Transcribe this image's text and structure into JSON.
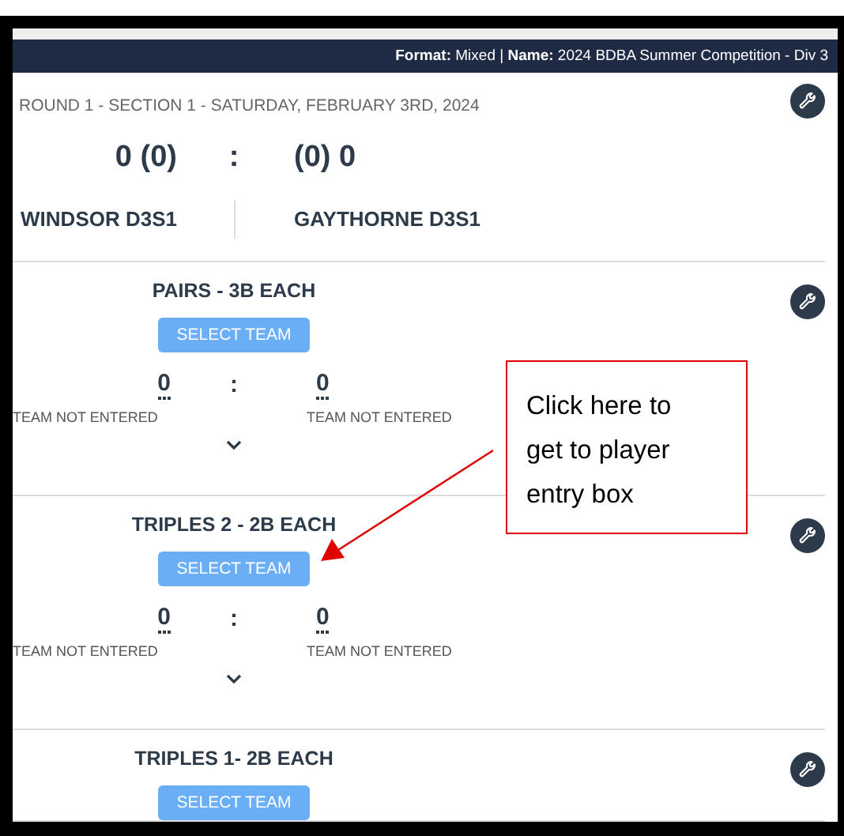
{
  "header": {
    "info": "**Format:** Mixed | **Name:** 2024 BDBA Summer Competition - Div 3"
  },
  "match": {
    "round": "ROUND 1 - SECTION 1 - SATURDAY, FEBRUARY 3RD, 2024",
    "home_score": "0 (0)",
    "separator": ":",
    "away_score": "(0) 0",
    "home_team": "WINDSOR D3S1",
    "away_team": "GAYTHORNE D3S1"
  },
  "games": [
    {
      "title": "PAIRS - 3B EACH",
      "button": "SELECT TEAM",
      "home_score": "0",
      "separator": ":",
      "away_score": "0",
      "home_status": "TEAM NOT ENTERED",
      "away_status": "TEAM NOT ENTERED"
    },
    {
      "title": "TRIPLES 2 - 2B EACH",
      "button": "SELECT TEAM",
      "home_score": "0",
      "separator": ":",
      "away_score": "0",
      "home_status": "TEAM NOT ENTERED",
      "away_status": "TEAM NOT ENTERED"
    },
    {
      "title": "TRIPLES 1- 2B EACH",
      "button": "SELECT TEAM"
    }
  ],
  "annotation": {
    "text": "Click here to get to player entry box"
  }
}
